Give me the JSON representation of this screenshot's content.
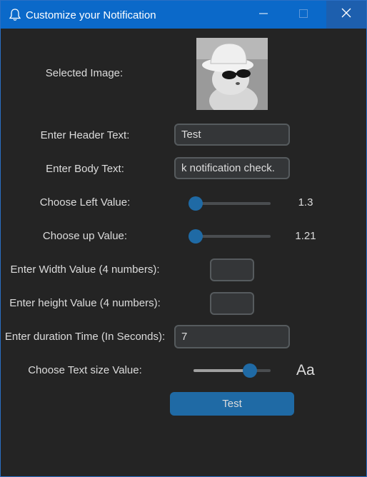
{
  "window": {
    "title": "Customize your Notification",
    "title_icon": "bell-icon",
    "controls": [
      "minimize-icon",
      "maximize-icon",
      "close-icon"
    ],
    "accent": "#0b69c9"
  },
  "form": {
    "selected_image_label": "Selected Image:",
    "header_label": "Enter Header Text:",
    "header_value": "Test",
    "body_label": "Enter Body Text:",
    "body_value": "k notification check.",
    "left_label": "Choose Left Value:",
    "left_value": "1.3",
    "left_level": 0.0,
    "up_label": "Choose up Value:",
    "up_value": "1.21",
    "up_level": 0.0,
    "width_label": "Enter Width Value (4 numbers):",
    "width_value": "",
    "height_label": "Enter height Value (4 numbers):",
    "height_value": "",
    "duration_label": "Enter duration Time (In Seconds):",
    "duration_value": "7",
    "textsize_label": "Choose Text size Value:",
    "textsize_level": 0.73,
    "textsize_preview": "Aa",
    "test_button": "Test"
  },
  "colors": {
    "background": "#242424",
    "button": "#1f6aa5",
    "entry_border": "#565b5e"
  }
}
